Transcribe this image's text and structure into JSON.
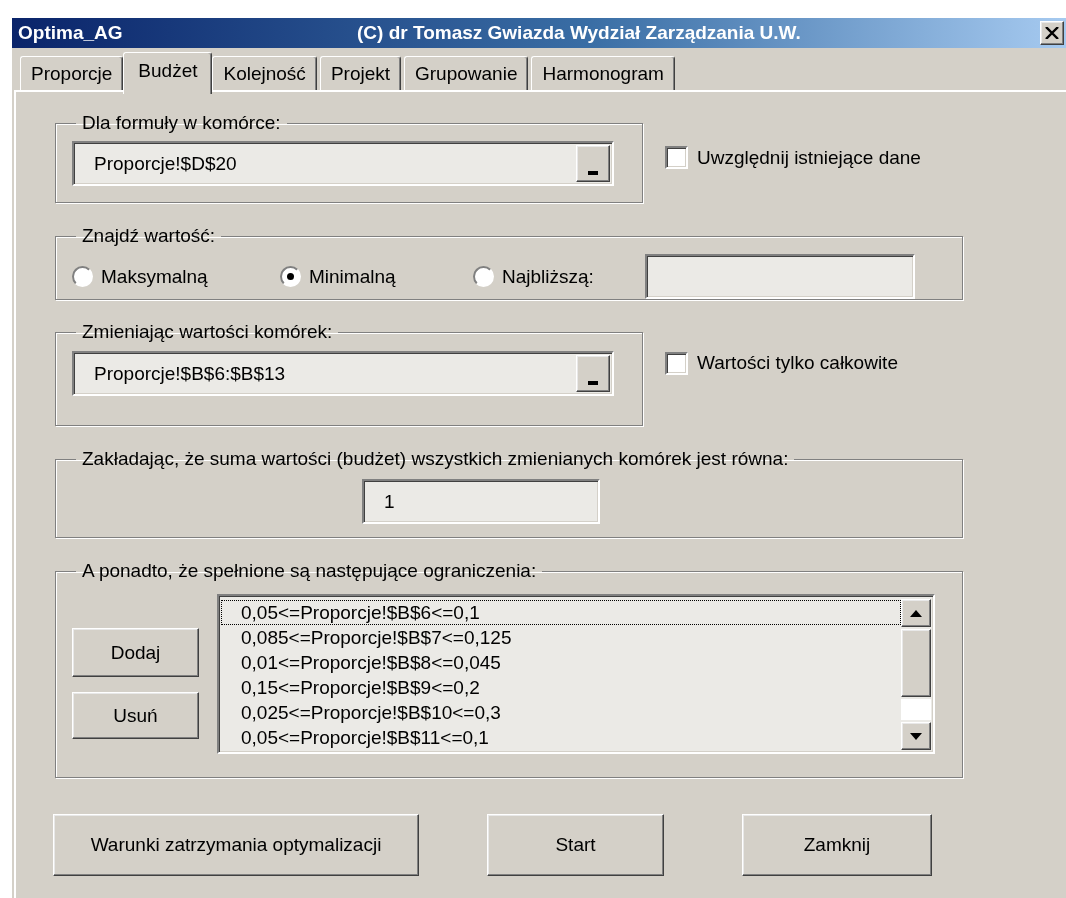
{
  "window": {
    "title": "Optima_AG",
    "caption": "(C) dr Tomasz Gwiazda Wydział Zarządzania U.W."
  },
  "tabs": [
    {
      "label": "Proporcje",
      "selected": false
    },
    {
      "label": "Budżet",
      "selected": true
    },
    {
      "label": "Kolejność",
      "selected": false
    },
    {
      "label": "Projekt",
      "selected": false
    },
    {
      "label": "Grupowanie",
      "selected": false
    },
    {
      "label": "Harmonogram",
      "selected": false
    }
  ],
  "formula_cell": {
    "legend": "Dla formuły w komórce:",
    "value": "Proporcje!$D$20",
    "checkbox": {
      "label": "Uwzględnij istniejące dane",
      "checked": false
    }
  },
  "find_value": {
    "legend": "Znajdź wartość:",
    "options": [
      {
        "label": "Maksymalną",
        "selected": false
      },
      {
        "label": "Minimalną",
        "selected": true
      },
      {
        "label": "Najbliższą:",
        "selected": false
      }
    ]
  },
  "changing_cells": {
    "legend": "Zmieniając wartości komórek:",
    "value": "Proporcje!$B$6:$B$13",
    "checkbox": {
      "label": "Wartości tylko całkowite",
      "checked": false
    }
  },
  "budget": {
    "legend": "Zakładając, że suma wartości (budżet) wszystkich zmienianych komórek jest równa:",
    "value": "1"
  },
  "constraints": {
    "legend": "A ponadto, że spełnione są następujące ograniczenia:",
    "buttons": [
      "Dodaj",
      "Usuń"
    ],
    "items": [
      {
        "text": "0,05<=Proporcje!$B$6<=0,1",
        "focused": true
      },
      {
        "text": "0,085<=Proporcje!$B$7<=0,125",
        "focused": false
      },
      {
        "text": "0,01<=Proporcje!$B$8<=0,045",
        "focused": false
      },
      {
        "text": "0,15<=Proporcje!$B$9<=0,2",
        "focused": false
      },
      {
        "text": "0,025<=Proporcje!$B$10<=0,3",
        "focused": false
      },
      {
        "text": "0,05<=Proporcje!$B$11<=0,1",
        "focused": false
      }
    ]
  },
  "buttons": [
    "Warunki zatrzymania optymalizacji",
    "Start",
    "Zamknij"
  ]
}
